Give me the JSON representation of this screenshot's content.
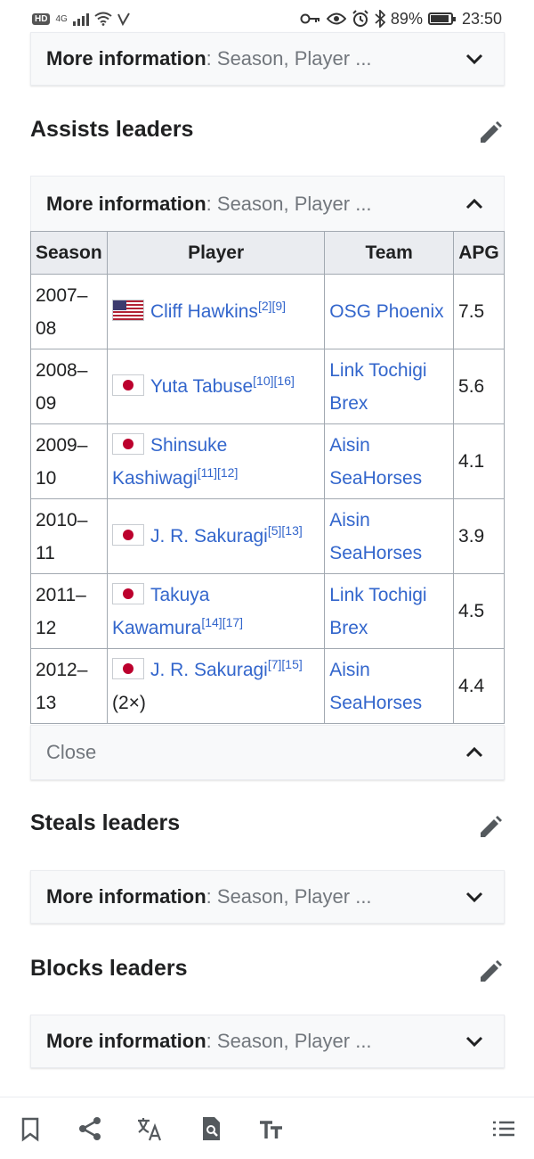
{
  "status_bar": {
    "network": "4G",
    "battery": "89%",
    "battery_level": 0.89,
    "time": "23:50"
  },
  "more_info": {
    "label": "More information",
    "rest": ": Season, Player ..."
  },
  "sections": {
    "assists_title": "Assists leaders",
    "steals_title": "Steals leaders",
    "blocks_title": "Blocks leaders"
  },
  "assists_table": {
    "headers": [
      "Season",
      "Player",
      "Team",
      "APG"
    ],
    "rows": [
      {
        "season": "2007–08",
        "flag": "us",
        "player": "Cliff Hawkins",
        "refs": "[2][9]",
        "suffix": "",
        "team": "OSG Phoenix",
        "apg": "7.5"
      },
      {
        "season": "2008–09",
        "flag": "jp",
        "player": "Yuta Tabuse",
        "refs": "[10][16]",
        "suffix": "",
        "team": "Link Tochigi Brex",
        "apg": "5.6"
      },
      {
        "season": "2009–10",
        "flag": "jp",
        "player": "Shinsuke Kashiwagi",
        "refs": "[11][12]",
        "suffix": "",
        "team": "Aisin SeaHorses",
        "apg": "4.1"
      },
      {
        "season": "2010–11",
        "flag": "jp",
        "player": "J. R. Sakuragi",
        "refs": "[5][13]",
        "suffix": "",
        "team": "Aisin SeaHorses",
        "apg": "3.9"
      },
      {
        "season": "2011–12",
        "flag": "jp",
        "player": "Takuya Kawamura",
        "refs": "[14][17]",
        "suffix": "",
        "team": "Link Tochigi Brex",
        "apg": "4.5"
      },
      {
        "season": "2012–13",
        "flag": "jp",
        "player": "J. R. Sakuragi",
        "refs": "[7][15]",
        "suffix": "(2×)",
        "team": "Aisin SeaHorses",
        "apg": "4.4"
      }
    ],
    "close_label": "Close"
  },
  "colors": {
    "link": "#3366cc",
    "header_bg": "#eaecf0",
    "bar_bg": "#f8f9fa"
  },
  "icons": {
    "edit": "pencil-icon",
    "expand": "chevron-down-icon",
    "collapse": "chevron-up-icon",
    "bottom_bar": [
      "bookmark-icon",
      "share-icon",
      "translate-icon",
      "find-in-page-icon",
      "text-size-icon",
      "contents-list-icon"
    ]
  }
}
